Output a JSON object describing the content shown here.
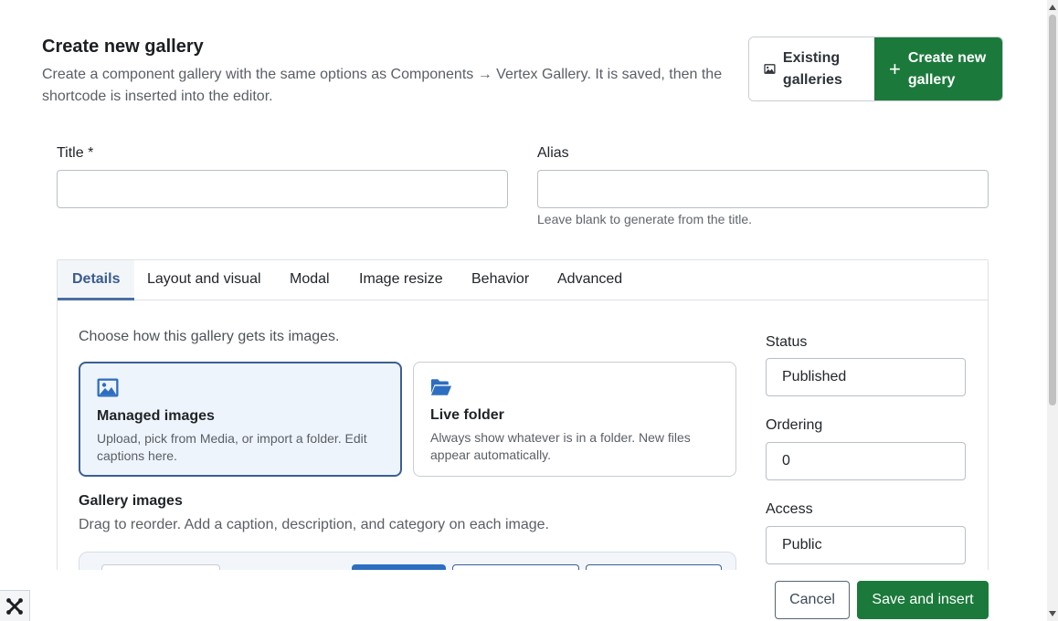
{
  "header": {
    "title": "Create new gallery",
    "description": "Create a component gallery with the same options as Components → Vertex Gallery. It is saved, then the shortcode is inserted into the editor."
  },
  "mode_toggle": {
    "existing_label": "Existing galleries",
    "create_label": "Create new gallery"
  },
  "form": {
    "title_label": "Title *",
    "title_value": "",
    "alias_label": "Alias",
    "alias_value": "",
    "alias_help": "Leave blank to generate from the title."
  },
  "tabs": [
    {
      "label": "Details"
    },
    {
      "label": "Layout and visual"
    },
    {
      "label": "Modal"
    },
    {
      "label": "Image resize"
    },
    {
      "label": "Behavior"
    },
    {
      "label": "Advanced"
    }
  ],
  "details": {
    "source_prompt": "Choose how this gallery gets its images.",
    "sources": [
      {
        "title": "Managed images",
        "description": "Upload, pick from Media, or import a folder. Edit captions here.",
        "icon": "image-icon",
        "selected": true
      },
      {
        "title": "Live folder",
        "description": "Always show whatever is in a folder. New files appear automatically.",
        "icon": "folder-open-icon",
        "selected": false
      }
    ],
    "gallery_images_title": "Gallery images",
    "gallery_images_desc": "Drag to reorder. Add a caption, description, and category on each image."
  },
  "sidebar": {
    "status_label": "Status",
    "status_value": "Published",
    "ordering_label": "Ordering",
    "ordering_value": "0",
    "access_label": "Access",
    "access_value": "Public"
  },
  "footer": {
    "cancel_label": "Cancel",
    "save_label": "Save and insert"
  },
  "colors": {
    "primary_green": "#1b7a3b",
    "accent_blue": "#3b5f94",
    "icon_blue": "#2d6ec0"
  }
}
